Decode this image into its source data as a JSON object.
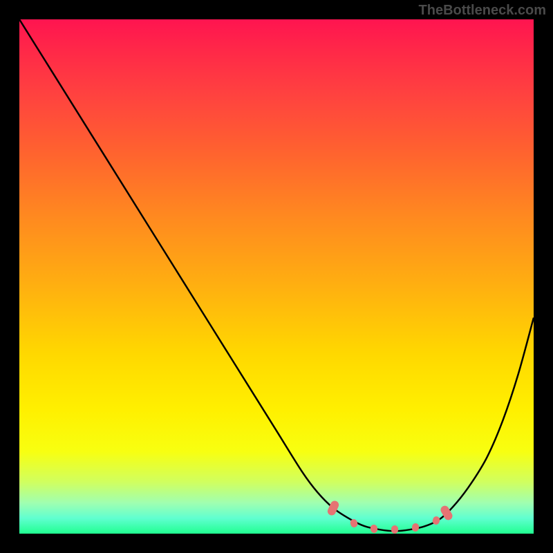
{
  "attribution": "TheBottleneck.com",
  "chart_data": {
    "type": "line",
    "title": "",
    "xlabel": "",
    "ylabel": "",
    "xlim": [
      0,
      100
    ],
    "ylim": [
      0,
      100
    ],
    "series": [
      {
        "name": "bottleneck-curve",
        "x": [
          0,
          5,
          10,
          15,
          20,
          25,
          30,
          35,
          40,
          45,
          50,
          55,
          58,
          61,
          64,
          67,
          70,
          73,
          76,
          79,
          82,
          85,
          88,
          91,
          94,
          97,
          100
        ],
        "y": [
          100,
          92,
          84,
          76,
          68,
          60,
          52,
          44,
          36,
          28,
          20,
          12,
          8,
          5,
          3,
          1.5,
          0.8,
          0.5,
          0.8,
          1.5,
          3,
          6,
          10,
          15,
          22,
          31,
          42
        ]
      }
    ],
    "optimal_range": {
      "start": 61,
      "end": 82
    },
    "markers": [
      {
        "x": 61,
        "y": 5
      },
      {
        "x": 65,
        "y": 2
      },
      {
        "x": 69,
        "y": 1
      },
      {
        "x": 73,
        "y": 0.8
      },
      {
        "x": 77,
        "y": 1.2
      },
      {
        "x": 81,
        "y": 2.5
      },
      {
        "x": 83,
        "y": 4
      }
    ]
  }
}
